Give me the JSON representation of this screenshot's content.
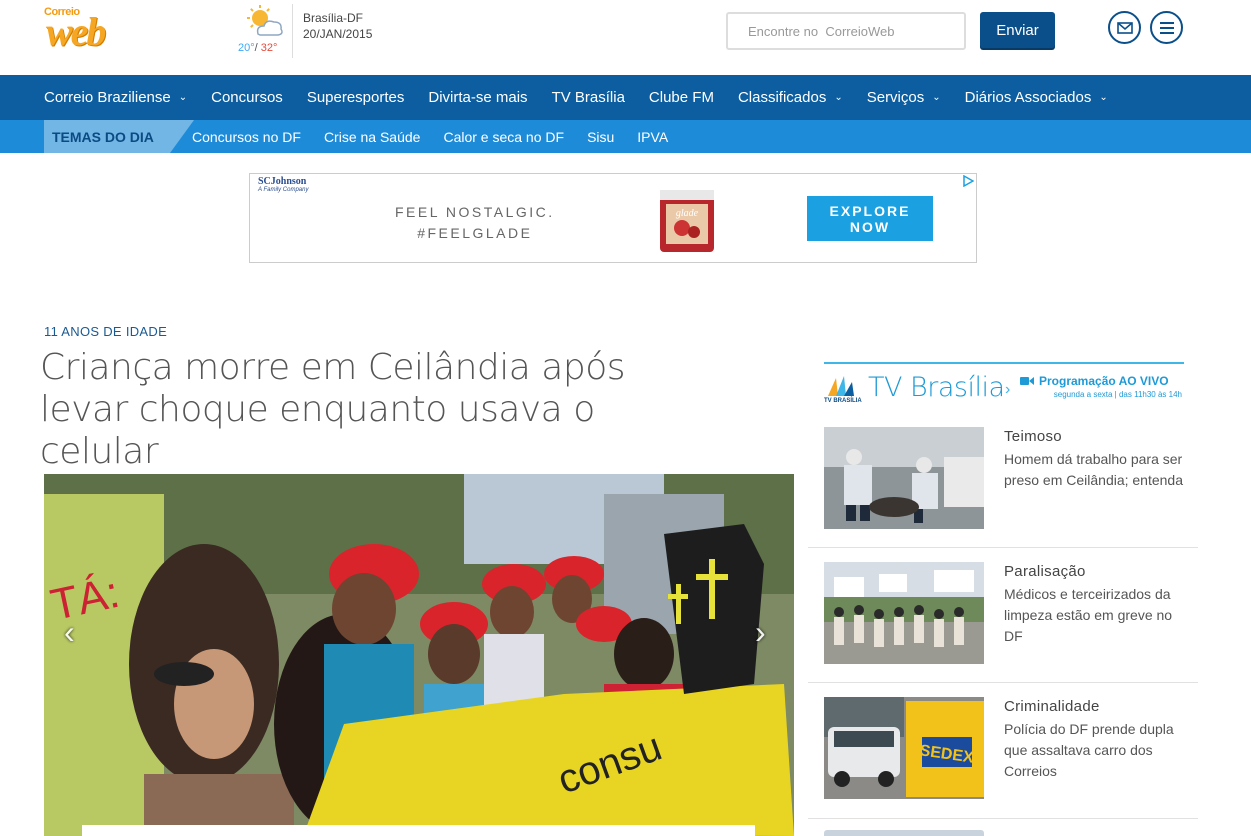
{
  "header": {
    "logo_small": "Correio",
    "logo_big": "web",
    "weather": {
      "min": "20°",
      "separator": "/",
      "max": "32°",
      "icon": "partly-cloudy-icon"
    },
    "city": "Brasília-DF",
    "date": "20/JAN/2015",
    "search": {
      "placeholder": "Encontre no  CorreioWeb"
    },
    "send_label": "Enviar"
  },
  "nav": {
    "items": [
      {
        "label": "Correio Braziliense",
        "dropdown": true
      },
      {
        "label": "Concursos",
        "dropdown": false
      },
      {
        "label": "Superesportes",
        "dropdown": false
      },
      {
        "label": "Divirta-se mais",
        "dropdown": false
      },
      {
        "label": "TV Brasília",
        "dropdown": false
      },
      {
        "label": "Clube FM",
        "dropdown": false
      },
      {
        "label": "Classificados",
        "dropdown": true
      },
      {
        "label": "Serviços",
        "dropdown": true
      },
      {
        "label": "Diários Associados",
        "dropdown": true
      }
    ],
    "chevron": "⌄"
  },
  "topics": {
    "label": "TEMAS DO DIA",
    "items": [
      "Concursos no DF",
      "Crise na Saúde",
      "Calor e seca no DF",
      "Sisu",
      "IPVA"
    ]
  },
  "ad": {
    "brand": "SCJohnson",
    "brand_sub": "A Family Company",
    "slogan_line1": "FEEL NOSTALGIC.",
    "slogan_line2": "#FEELGLADE",
    "product_label": "glade",
    "cta_line1": "EXPLORE",
    "cta_line2": "NOW"
  },
  "article": {
    "kicker": "11 ANOS DE IDADE",
    "headline_line1": "Criança morre em Ceilândia após",
    "headline_line2": " levar choque enquanto usava o celular",
    "photo_sign_text": "TÁ:"
  },
  "sidebar": {
    "logo_label": "TV BRASÍLIA",
    "title": "TV Brasília",
    "live_label": "Programação AO VIVO",
    "live_schedule": "segunda a sexta | das 11h30 às 14h",
    "stories": [
      {
        "tag": "Teimoso",
        "text": "Homem dá trabalho para ser preso em Ceilândia; entenda"
      },
      {
        "tag": "Paralisação",
        "text": "Médicos e terceirizados da limpeza estão em greve no DF"
      },
      {
        "tag": "Criminalidade",
        "text": "Polícia do DF prende dupla que assaltava carro dos Correios",
        "thumb_label": "SEDEX"
      }
    ]
  },
  "colors": {
    "nav_blue": "#0c5ea0",
    "topics_blue": "#1e8bd8",
    "accent": "#1e9ad6",
    "logo_orange": "#f5a623"
  }
}
